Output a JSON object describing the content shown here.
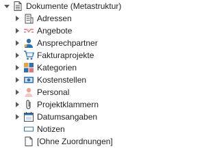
{
  "tree": {
    "root": {
      "label": "Dokumente (Metastruktur)",
      "icon": "document-icon",
      "expanded": true
    },
    "items": [
      {
        "label": "Adressen",
        "icon": "building-icon",
        "expandable": true
      },
      {
        "label": "Angebote",
        "icon": "handshake-icon",
        "expandable": true
      },
      {
        "label": "Ansprechpartner",
        "icon": "contact-person-icon",
        "expandable": true
      },
      {
        "label": "Fakturaprojekte",
        "icon": "shopping-cart-icon",
        "expandable": true
      },
      {
        "label": "Kategorien",
        "icon": "categories-icon",
        "expandable": true
      },
      {
        "label": "Kostenstellen",
        "icon": "money-icon",
        "expandable": true
      },
      {
        "label": "Personal",
        "icon": "person-icon",
        "expandable": true
      },
      {
        "label": "Projektklammern",
        "icon": "paperclip-icon",
        "expandable": true
      },
      {
        "label": "Datumsangaben",
        "icon": "calendar-icon",
        "expandable": true
      },
      {
        "label": "Notizen",
        "icon": "note-icon",
        "expandable": false
      },
      {
        "label": "[Ohne Zuordnungen]",
        "icon": "no-assignment-icon",
        "expandable": false
      }
    ]
  },
  "colors": {
    "arrow": "#5a5a5a",
    "text": "#1f1f1f",
    "blue": "#2e6fb4",
    "orange": "#e8a33a",
    "pink": "#e07a7a"
  }
}
